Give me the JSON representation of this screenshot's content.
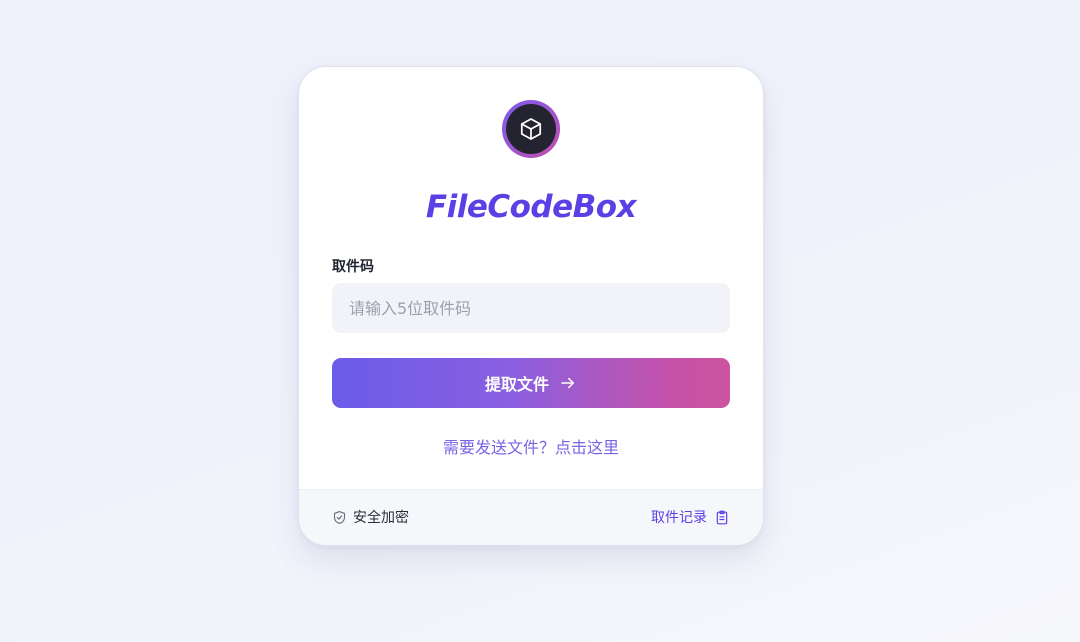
{
  "brand": {
    "name": "FileCodeBox",
    "logo_icon": "cube-icon",
    "color": "#5b40e6"
  },
  "form": {
    "label": "取件码",
    "placeholder": "请输入5位取件码",
    "value": "",
    "submit_label": "提取文件",
    "submit_icon": "arrow-right-icon"
  },
  "send_link": "需要发送文件？点击这里",
  "footer": {
    "security_label": "安全加密",
    "security_icon": "shield-check-icon",
    "history_label": "取件记录",
    "history_icon": "clipboard-list-icon"
  },
  "colors": {
    "accent": "#5b40e6",
    "gradient_start": "#6a5ce9",
    "gradient_end": "#cc53a0",
    "link": "#7a62e6"
  }
}
